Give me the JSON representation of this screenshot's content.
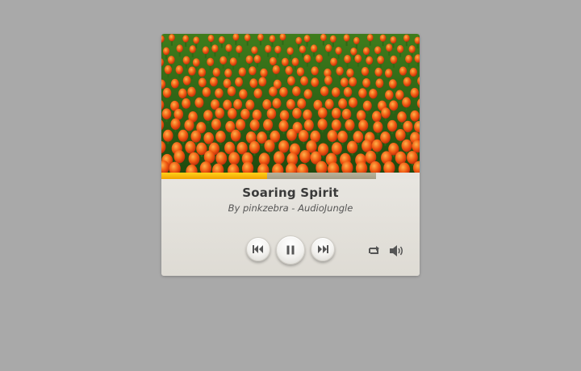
{
  "track": {
    "title": "Soaring Spirit",
    "artist_line": "By pinkzebra - AudioJungle",
    "artwork": "tulip-field"
  },
  "progress": {
    "played_fraction": 0.41,
    "buffered_fraction": 0.83
  },
  "controls": {
    "prev_icon": "skip-back-icon",
    "play_state_icon": "pause-icon",
    "next_icon": "skip-forward-icon",
    "repeat_icon": "repeat-icon",
    "volume_icon": "volume-icon"
  },
  "colors": {
    "background": "#a9a9a9",
    "accent": "#f7b800",
    "buffer": "#ada690"
  }
}
